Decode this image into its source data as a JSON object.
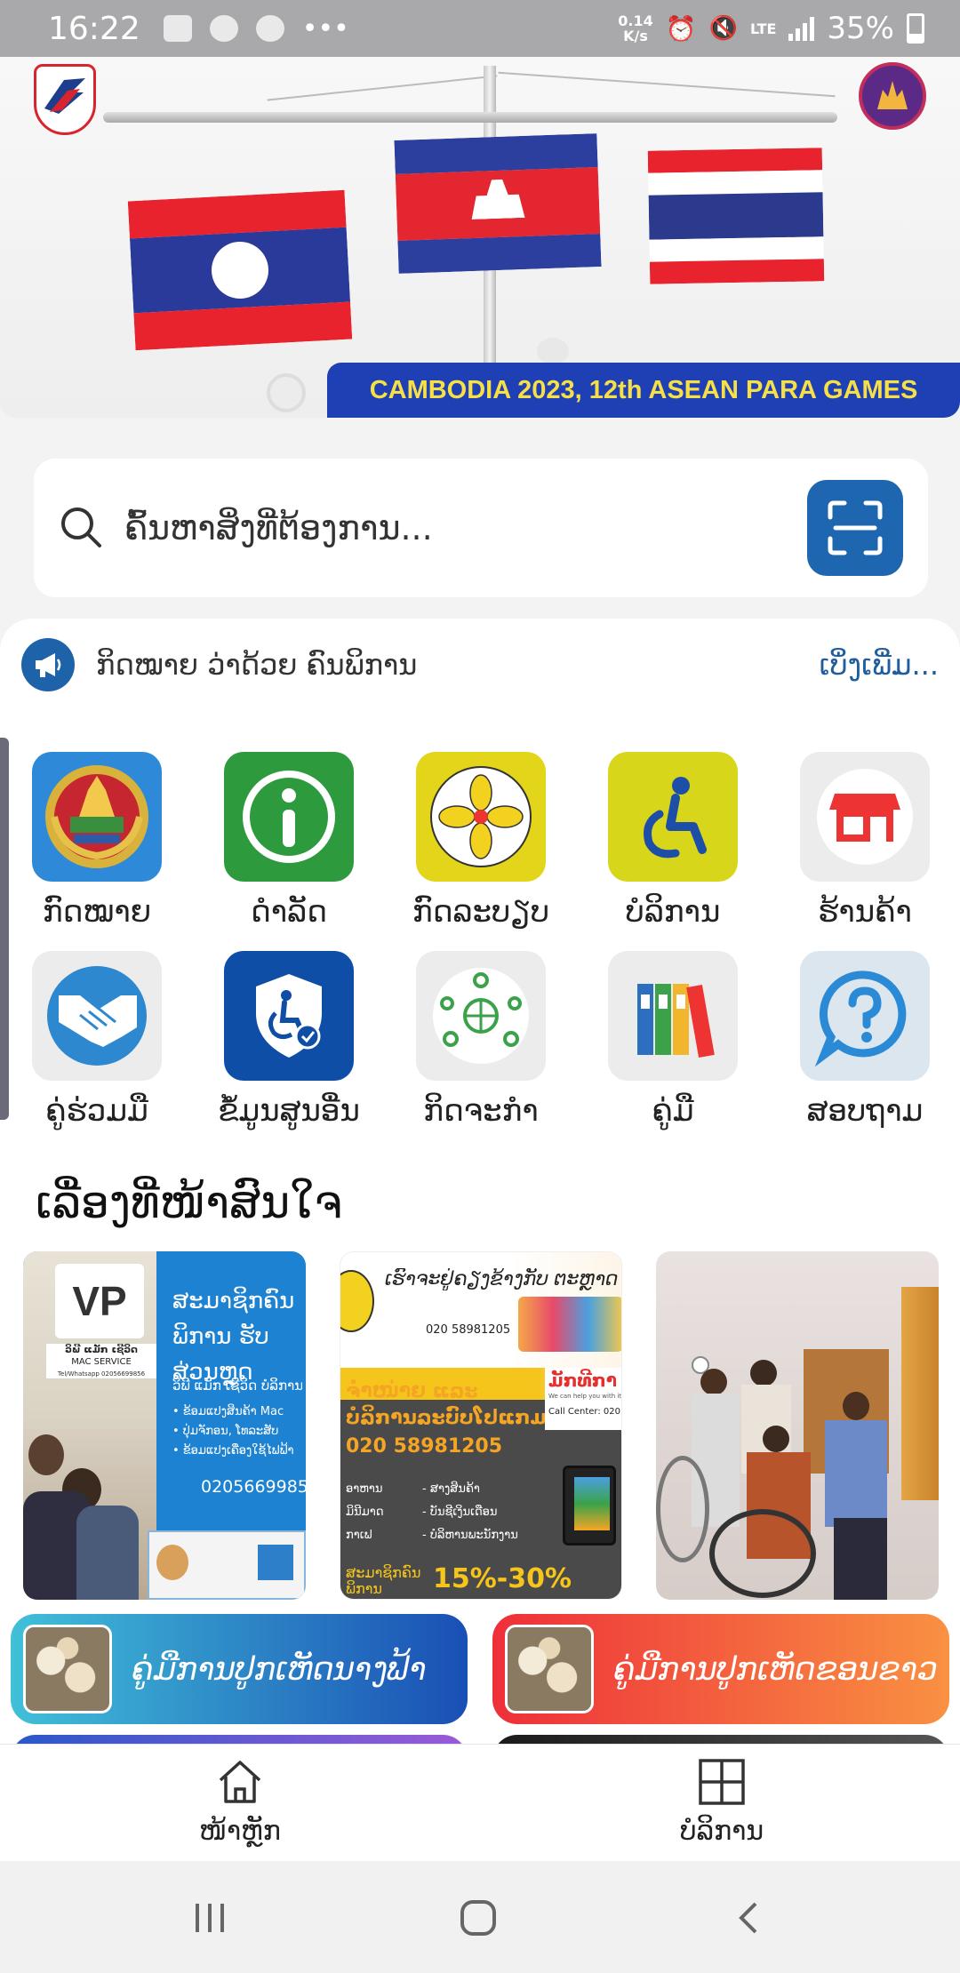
{
  "status_bar": {
    "time": "16:22",
    "net_speed_value": "0.14",
    "net_speed_unit": "K/s",
    "network": "LTE",
    "battery": "35%",
    "notification_icons": [
      "image-icon",
      "line-icon",
      "facebook-icon",
      "more-icon"
    ]
  },
  "banner": {
    "caption": "CAMBODIA 2023, 12th ASEAN PARA GAMES"
  },
  "search": {
    "placeholder": "ຄົ້ນຫາສິ່ງທີ່ຕ້ອງການ..."
  },
  "announcement": {
    "text": "ກິດໝາຍ ວ່າດ້ວຍ ຄົນພິການ",
    "see_more": "ເບິ່ງເພີ່ມ..."
  },
  "menu": [
    {
      "label": "ກົດໝາຍ",
      "icon": "lao-emblem-icon"
    },
    {
      "label": "ດຳລັດ",
      "icon": "info-icon"
    },
    {
      "label": "ກົດລະບຽບ",
      "icon": "association-logo-icon"
    },
    {
      "label": "ບໍລິການ",
      "icon": "wheelchair-icon"
    },
    {
      "label": "ຮ້ານຄ້າ",
      "icon": "shop-icon"
    },
    {
      "label": "ຄູ່ຮ່ວມມື",
      "icon": "handshake-icon"
    },
    {
      "label": "ຂໍ້ມູນສູນອື່ນ",
      "icon": "shield-wheelchair-icon"
    },
    {
      "label": "ກິດຈະກຳ",
      "icon": "network-people-icon"
    },
    {
      "label": "ຄູ່ມື",
      "icon": "binders-icon"
    },
    {
      "label": "ສອບຖາມ",
      "icon": "question-icon"
    }
  ],
  "news_section": {
    "title": "ເລື່ອງທີ່ໜ້າສົນໃຈ",
    "items": [
      {
        "brand": "VP",
        "name_lao": "ວິພີ ແມັກ ເຊີວິດ",
        "name": "MAC SERVICE",
        "contact": "Tel/Whatsapp 02056699856",
        "headline": "ສະມາຊິກຄົນພິການ ຮັບສ່ວນຫຼຸດ",
        "service_name": "ວິພີ ແມັກ ເຊີວິດ ບໍລິການ",
        "bullets": [
          "• ຂ້ອມແປງສິນຄ້າ Mac",
          "• ປຸ່ມຈັກອນ, ໂທລະສັບ",
          "• ຂ້ອມແປງເຄື່ອງໃຊ້ໄຟຟ້າ"
        ],
        "phone": "02056699856"
      },
      {
        "headline": "ເຮົາຈະຢູ່ຄຽງຂ້າງກັບ ຕະຫຼາດ",
        "contact": "020 58981205",
        "banner": "ຈຳໜ່າຍ ແລະ ບໍລິການລະບົບໂປແກມ",
        "phone": "020 58981205",
        "brand": "ມັກທີກາ",
        "brand_tagline": "We can help you with it",
        "call_center": "Call Center: 020",
        "rows": [
          "ອາຫານ",
          "ມິນີມາດ",
          "ກາເຟ"
        ],
        "rows_right": [
          "- ສາງສິນຄ້າ",
          "- ບັນຊີເງິນເດືອນ",
          "- ບໍລິຫານພະນັກງານ"
        ],
        "member": "ສະມາຊິກຄົນພິການ",
        "discount": "15%-30%"
      },
      {
        "image": "group-photo-wheelchair"
      }
    ]
  },
  "guides": [
    {
      "label": "ຄູ່ມືການປູກເຫັດນາງຟ້າ",
      "colors": [
        "#41c0d8",
        "#1a4fb5"
      ]
    },
    {
      "label": "ຄູ່ມືການປູກເຫັດຂອນຂາວ",
      "colors": [
        "#ee2f3a",
        "#f99142"
      ]
    }
  ],
  "bottom_nav": [
    {
      "label": "ໜ້າຫຼັກ",
      "icon": "home-icon"
    },
    {
      "label": "ບໍລິການ",
      "icon": "grid-icon"
    }
  ],
  "colors": {
    "primary": "#1e63aa",
    "banner_caption_bg": "#1f3fb5",
    "banner_caption_text": "#f6e046"
  }
}
